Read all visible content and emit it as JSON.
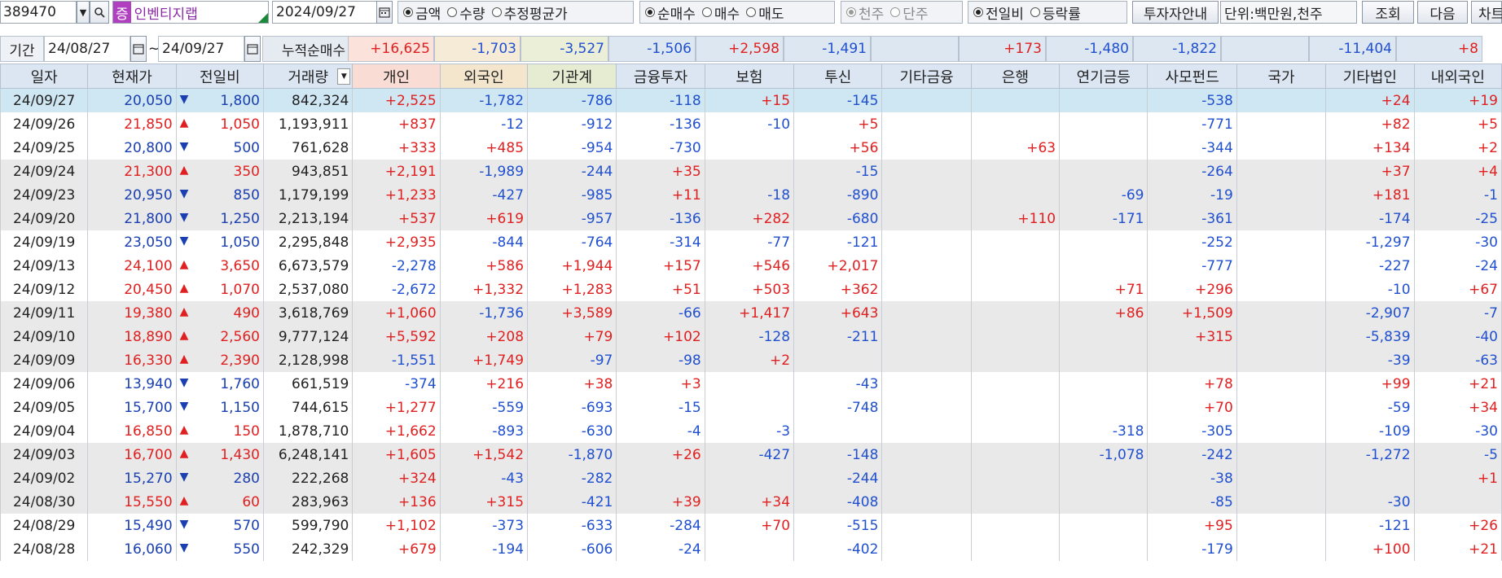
{
  "toolbar": {
    "code": "389470",
    "stock_badge": "증",
    "stock_name": "인벤티지랩",
    "date": "2024/09/27",
    "radio_group_1": [
      {
        "label": "금액",
        "on": true
      },
      {
        "label": "수량",
        "on": false
      },
      {
        "label": "추정평균가",
        "on": false
      }
    ],
    "radio_group_2": [
      {
        "label": "순매수",
        "on": true
      },
      {
        "label": "매수",
        "on": false
      },
      {
        "label": "매도",
        "on": false
      }
    ],
    "radio_group_3": [
      {
        "label": "천주",
        "on": true
      },
      {
        "label": "단주",
        "on": false
      }
    ],
    "radio_group_4": [
      {
        "label": "전일비",
        "on": true
      },
      {
        "label": "등락률",
        "on": false
      }
    ],
    "investor_guide": "투자자안내",
    "unit": "단위:백만원,천주",
    "query": "조회",
    "next": "다음",
    "chart": "차트"
  },
  "period": {
    "label": "기간",
    "from": "24/08/27",
    "tilde": "~",
    "to": "24/09/27",
    "cum_label": "누적순매수",
    "cum_values": [
      "+16,625",
      "-1,703",
      "-3,527",
      "-1,506",
      "+2,598",
      "-1,491",
      "",
      "+173",
      "-1,480",
      "-1,822",
      "",
      "-11,404",
      "+8"
    ]
  },
  "columns": [
    "일자",
    "현재가",
    "전일비",
    "거래량",
    "개인",
    "외국인",
    "기관계",
    "금융투자",
    "보험",
    "투신",
    "기타금융",
    "은행",
    "연기금등",
    "사모펀드",
    "국가",
    "기타법인",
    "내외국인"
  ],
  "rows": [
    {
      "date": "24/09/27",
      "price": "20,050",
      "dir": "down",
      "chg": "1,800",
      "vol": "842,324",
      "v": [
        "+2,525",
        "-1,782",
        "-786",
        "-118",
        "+15",
        "-145",
        "",
        "",
        "",
        "-538",
        "",
        "+24",
        "+19"
      ]
    },
    {
      "date": "24/09/26",
      "price": "21,850",
      "dir": "up",
      "chg": "1,050",
      "vol": "1,193,911",
      "v": [
        "+837",
        "-12",
        "-912",
        "-136",
        "-10",
        "+5",
        "",
        "",
        "",
        "-771",
        "",
        "+82",
        "+5"
      ]
    },
    {
      "date": "24/09/25",
      "price": "20,800",
      "dir": "down",
      "chg": "500",
      "vol": "761,628",
      "v": [
        "+333",
        "+485",
        "-954",
        "-730",
        "",
        "+56",
        "",
        "+63",
        "",
        "-344",
        "",
        "+134",
        "+2"
      ]
    },
    {
      "date": "24/09/24",
      "price": "21,300",
      "dir": "up",
      "chg": "350",
      "vol": "943,851",
      "v": [
        "+2,191",
        "-1,989",
        "-244",
        "+35",
        "",
        "-15",
        "",
        "",
        "",
        "-264",
        "",
        "+37",
        "+4"
      ]
    },
    {
      "date": "24/09/23",
      "price": "20,950",
      "dir": "down",
      "chg": "850",
      "vol": "1,179,199",
      "v": [
        "+1,233",
        "-427",
        "-985",
        "+11",
        "-18",
        "-890",
        "",
        "",
        "-69",
        "-19",
        "",
        "+181",
        "-1"
      ]
    },
    {
      "date": "24/09/20",
      "price": "21,800",
      "dir": "down",
      "chg": "1,250",
      "vol": "2,213,194",
      "v": [
        "+537",
        "+619",
        "-957",
        "-136",
        "+282",
        "-680",
        "",
        "+110",
        "-171",
        "-361",
        "",
        "-174",
        "-25"
      ]
    },
    {
      "date": "24/09/19",
      "price": "23,050",
      "dir": "down",
      "chg": "1,050",
      "vol": "2,295,848",
      "v": [
        "+2,935",
        "-844",
        "-764",
        "-314",
        "-77",
        "-121",
        "",
        "",
        "",
        "-252",
        "",
        "-1,297",
        "-30"
      ]
    },
    {
      "date": "24/09/13",
      "price": "24,100",
      "dir": "up",
      "chg": "3,650",
      "vol": "6,673,579",
      "v": [
        "-2,278",
        "+586",
        "+1,944",
        "+157",
        "+546",
        "+2,017",
        "",
        "",
        "",
        "-777",
        "",
        "-227",
        "-24"
      ]
    },
    {
      "date": "24/09/12",
      "price": "20,450",
      "dir": "up",
      "chg": "1,070",
      "vol": "2,537,080",
      "v": [
        "-2,672",
        "+1,332",
        "+1,283",
        "+51",
        "+503",
        "+362",
        "",
        "",
        "+71",
        "+296",
        "",
        "-10",
        "+67"
      ]
    },
    {
      "date": "24/09/11",
      "price": "19,380",
      "dir": "up",
      "chg": "490",
      "vol": "3,618,769",
      "v": [
        "+1,060",
        "-1,736",
        "+3,589",
        "-66",
        "+1,417",
        "+643",
        "",
        "",
        "+86",
        "+1,509",
        "",
        "-2,907",
        "-7"
      ]
    },
    {
      "date": "24/09/10",
      "price": "18,890",
      "dir": "up",
      "chg": "2,560",
      "vol": "9,777,124",
      "v": [
        "+5,592",
        "+208",
        "+79",
        "+102",
        "-128",
        "-211",
        "",
        "",
        "",
        "+315",
        "",
        "-5,839",
        "-40"
      ]
    },
    {
      "date": "24/09/09",
      "price": "16,330",
      "dir": "up",
      "chg": "2,390",
      "vol": "2,128,998",
      "v": [
        "-1,551",
        "+1,749",
        "-97",
        "-98",
        "+2",
        "",
        "",
        "",
        "",
        "",
        "",
        "-39",
        "-63"
      ]
    },
    {
      "date": "24/09/06",
      "price": "13,940",
      "dir": "down",
      "chg": "1,760",
      "vol": "661,519",
      "v": [
        "-374",
        "+216",
        "+38",
        "+3",
        "",
        "-43",
        "",
        "",
        "",
        "+78",
        "",
        "+99",
        "+21"
      ]
    },
    {
      "date": "24/09/05",
      "price": "15,700",
      "dir": "down",
      "chg": "1,150",
      "vol": "744,615",
      "v": [
        "+1,277",
        "-559",
        "-693",
        "-15",
        "",
        "-748",
        "",
        "",
        "",
        "+70",
        "",
        "-59",
        "+34"
      ]
    },
    {
      "date": "24/09/04",
      "price": "16,850",
      "dir": "up",
      "chg": "150",
      "vol": "1,878,710",
      "v": [
        "+1,662",
        "-893",
        "-630",
        "-4",
        "-3",
        "",
        "",
        "",
        "-318",
        "-305",
        "",
        "-109",
        "-30"
      ]
    },
    {
      "date": "24/09/03",
      "price": "16,700",
      "dir": "up",
      "chg": "1,430",
      "vol": "6,248,141",
      "v": [
        "+1,605",
        "+1,542",
        "-1,870",
        "+26",
        "-427",
        "-148",
        "",
        "",
        "-1,078",
        "-242",
        "",
        "-1,272",
        "-5"
      ]
    },
    {
      "date": "24/09/02",
      "price": "15,270",
      "dir": "down",
      "chg": "280",
      "vol": "222,268",
      "v": [
        "+324",
        "-43",
        "-282",
        "",
        "",
        "-244",
        "",
        "",
        "",
        "-38",
        "",
        "",
        "+1"
      ]
    },
    {
      "date": "24/08/30",
      "price": "15,550",
      "dir": "up",
      "chg": "60",
      "vol": "283,963",
      "v": [
        "+136",
        "+315",
        "-421",
        "+39",
        "+34",
        "-408",
        "",
        "",
        "",
        "-85",
        "",
        "-30",
        ""
      ]
    },
    {
      "date": "24/08/29",
      "price": "15,490",
      "dir": "down",
      "chg": "570",
      "vol": "599,790",
      "v": [
        "+1,102",
        "-373",
        "-633",
        "-284",
        "+70",
        "-515",
        "",
        "",
        "",
        "+95",
        "",
        "-121",
        "+26"
      ]
    },
    {
      "date": "24/08/28",
      "price": "16,060",
      "dir": "down",
      "chg": "550",
      "vol": "242,329",
      "v": [
        "+679",
        "-194",
        "-606",
        "-24",
        "",
        "-402",
        "",
        "",
        "",
        "-179",
        "",
        "+100",
        "+21"
      ]
    }
  ],
  "colors": {
    "up": "#e02020",
    "down": "#2050d0",
    "header": "#dbe6f2",
    "selected": "#cfe7f3",
    "gray_row": "#e9e9e9",
    "badge": "#b040c0"
  }
}
